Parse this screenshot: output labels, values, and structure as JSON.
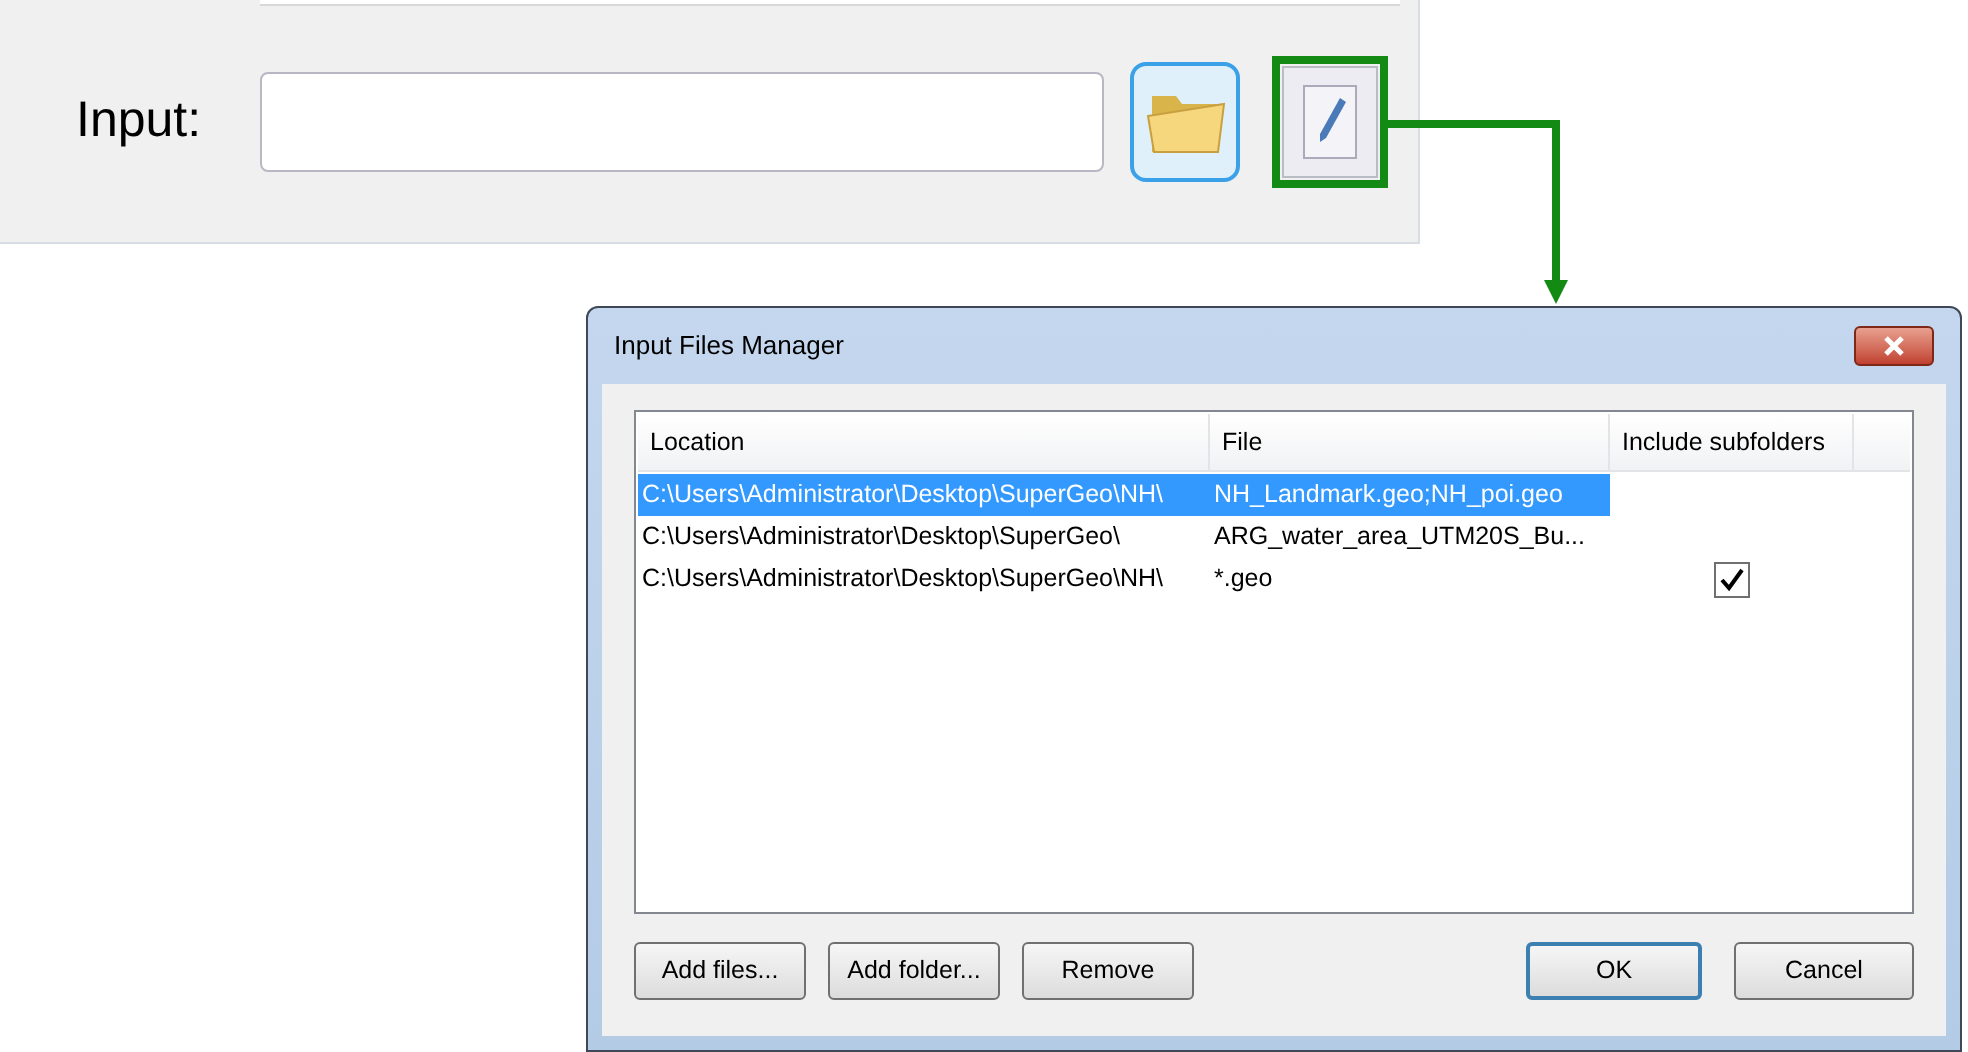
{
  "input_panel": {
    "label": "Input:"
  },
  "dialog": {
    "title": "Input Files Manager",
    "table": {
      "columns": [
        "Location",
        "File",
        "Include subfolders"
      ],
      "rows": [
        {
          "location": "C:\\Users\\Administrator\\Desktop\\SuperGeo\\NH\\",
          "file": "NH_Landmark.geo;NH_poi.geo",
          "include_subfolders": false,
          "selected": true
        },
        {
          "location": "C:\\Users\\Administrator\\Desktop\\SuperGeo\\",
          "file": "ARG_water_area_UTM20S_Bu...",
          "include_subfolders": false,
          "selected": false
        },
        {
          "location": "C:\\Users\\Administrator\\Desktop\\SuperGeo\\NH\\",
          "file": "*.geo",
          "include_subfolders": true,
          "selected": false
        }
      ]
    },
    "left_buttons": [
      "Add files...",
      "Add folder...",
      "Remove"
    ],
    "right_buttons": [
      {
        "label": "OK",
        "kind": "default"
      },
      {
        "label": "Cancel",
        "kind": "normal"
      }
    ]
  }
}
